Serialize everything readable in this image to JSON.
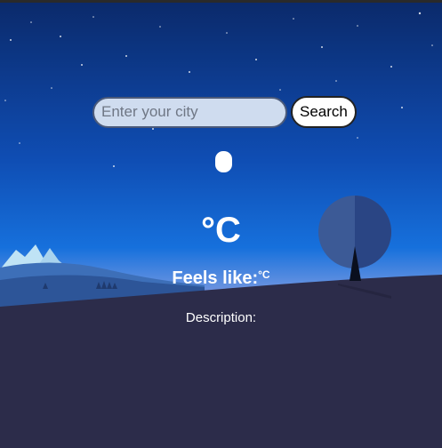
{
  "search": {
    "placeholder": "Enter your city",
    "value": "",
    "button_label": "Search"
  },
  "weather": {
    "temperature_value": "",
    "temperature_unit": "°C",
    "feels_like_label": "Feels like:",
    "feels_like_value": "",
    "feels_like_unit": "°C",
    "description_label": "Description:",
    "description_value": "",
    "icon": "weather-condition-icon"
  },
  "colors": {
    "sky_top": "#0b2a6b",
    "sky_mid": "#1565d0",
    "horizon": "#8e8fd8",
    "ground": "#2c2c4a",
    "mountain": "#bfe3f5",
    "tree_canopy": "#3c5a96",
    "tree_trunk": "#0a0f1e"
  }
}
